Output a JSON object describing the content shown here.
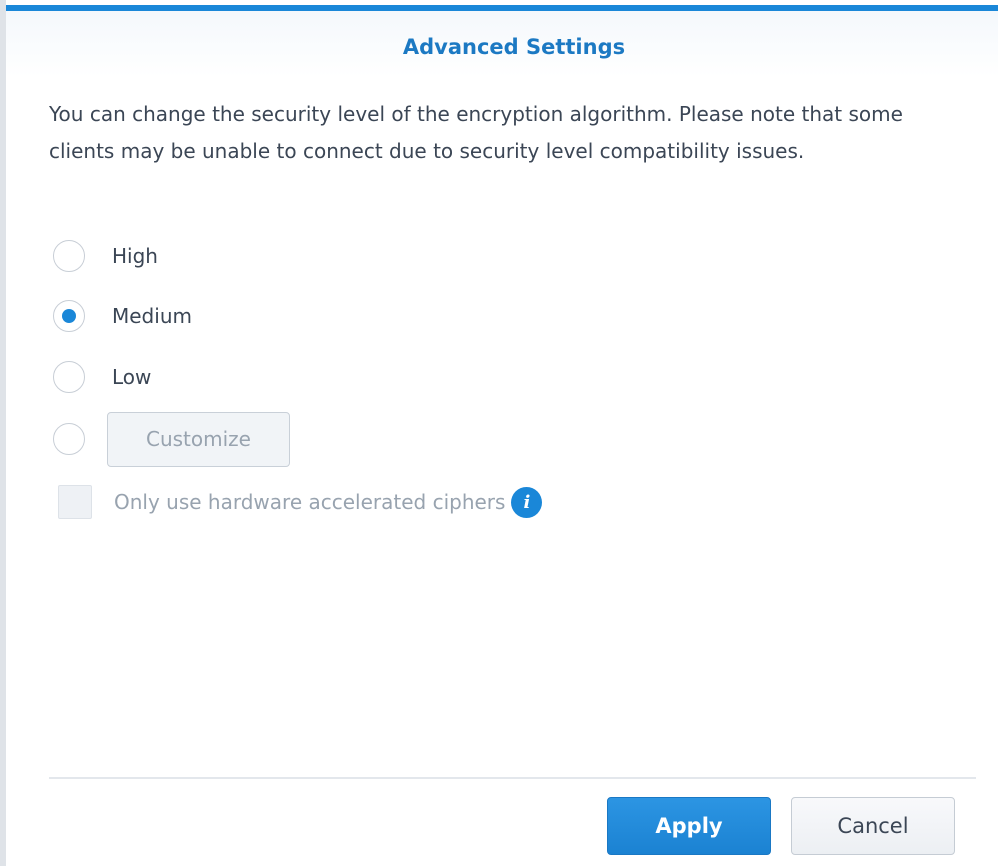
{
  "dialog": {
    "title": "Advanced Settings",
    "description": "You can change the security level of the encryption algorithm. Please note that some clients may be unable to connect due to security level compatibility issues."
  },
  "security_levels": {
    "selected": "Medium",
    "options": [
      {
        "label": "High",
        "checked": false
      },
      {
        "label": "Medium",
        "checked": true
      },
      {
        "label": "Low",
        "checked": false
      },
      {
        "label": "Customize",
        "checked": false,
        "disabled": true
      }
    ]
  },
  "hardware_ciphers": {
    "label": "Only use hardware accelerated ciphers",
    "checked": false,
    "disabled": true,
    "info_icon": "info-icon",
    "info_glyph": "i"
  },
  "footer": {
    "apply_label": "Apply",
    "cancel_label": "Cancel"
  },
  "colors": {
    "accent": "#1a87d8",
    "title": "#1c79c3",
    "text": "#3b4655",
    "disabled_text": "#98a3af"
  }
}
